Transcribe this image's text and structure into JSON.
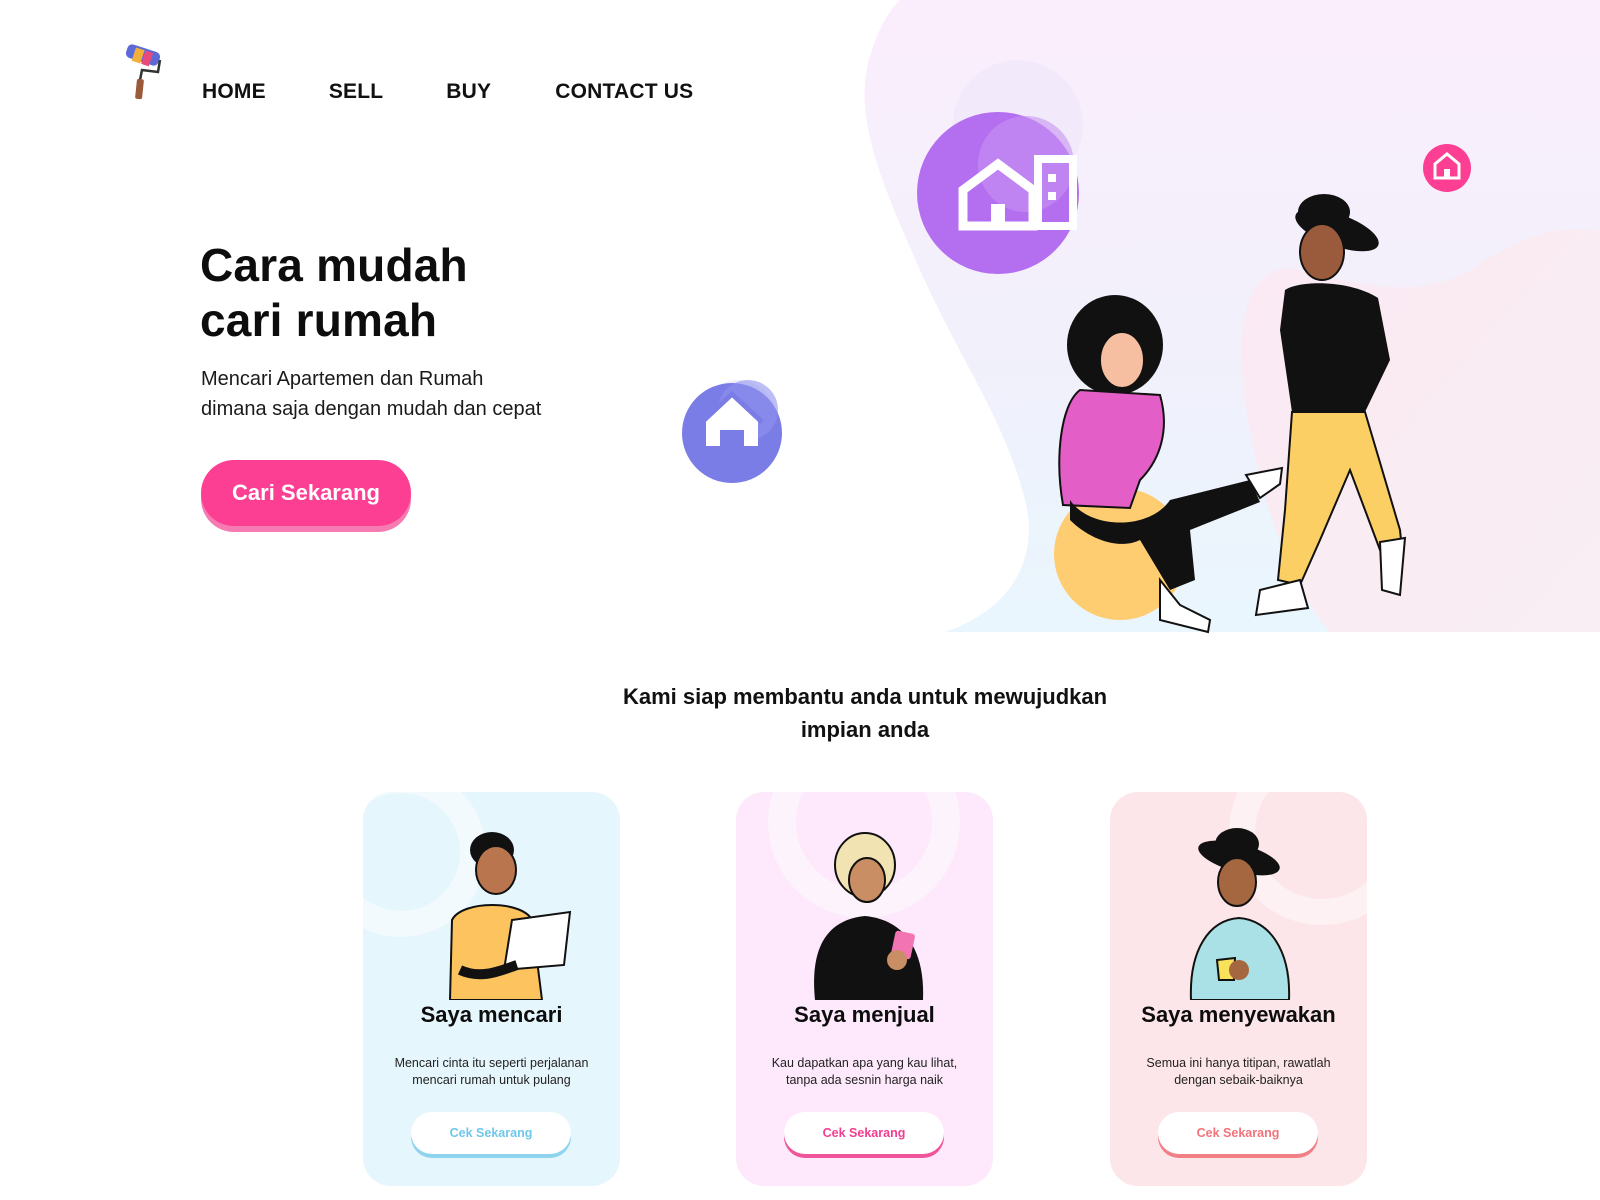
{
  "nav": {
    "home": "HOME",
    "sell": "SELL",
    "buy": "BUY",
    "contact": "CONTACT US"
  },
  "hero": {
    "title_line1": "Cara mudah",
    "title_line2": "cari rumah",
    "subtitle_line1": "Mencari Apartemen dan Rumah",
    "subtitle_line2": "dimana saja dengan mudah dan cepat",
    "cta": "Cari Sekarang"
  },
  "section": {
    "title_line1": "Kami siap membantu anda untuk mewujudkan",
    "title_line2": "impian anda"
  },
  "cards": [
    {
      "title": "Saya mencari",
      "text_line1": "Mencari cinta itu seperti perjalanan",
      "text_line2": "mencari rumah untuk pulang",
      "button": "Cek Sekarang"
    },
    {
      "title": "Saya menjual",
      "text_line1": "Kau dapatkan apa yang kau lihat,",
      "text_line2": "tanpa ada sesnin harga naik",
      "button": "Cek Sekarang"
    },
    {
      "title": "Saya menyewakan",
      "text_line1": "Semua ini hanya titipan, rawatlah",
      "text_line2": "dengan sebaik-baiknya",
      "button": "Cek Sekarang"
    }
  ],
  "colors": {
    "accent_pink": "#fc3f93",
    "purple_badge": "#b06cf1",
    "indigo_badge": "#7b7de6",
    "card_blue": "#e6f6fd",
    "card_pink": "#fde9fb",
    "card_rose": "#fde6e9"
  },
  "icons": [
    "paint-roller-logo-icon",
    "building-house-icon",
    "house-icon",
    "small-house-icon"
  ]
}
